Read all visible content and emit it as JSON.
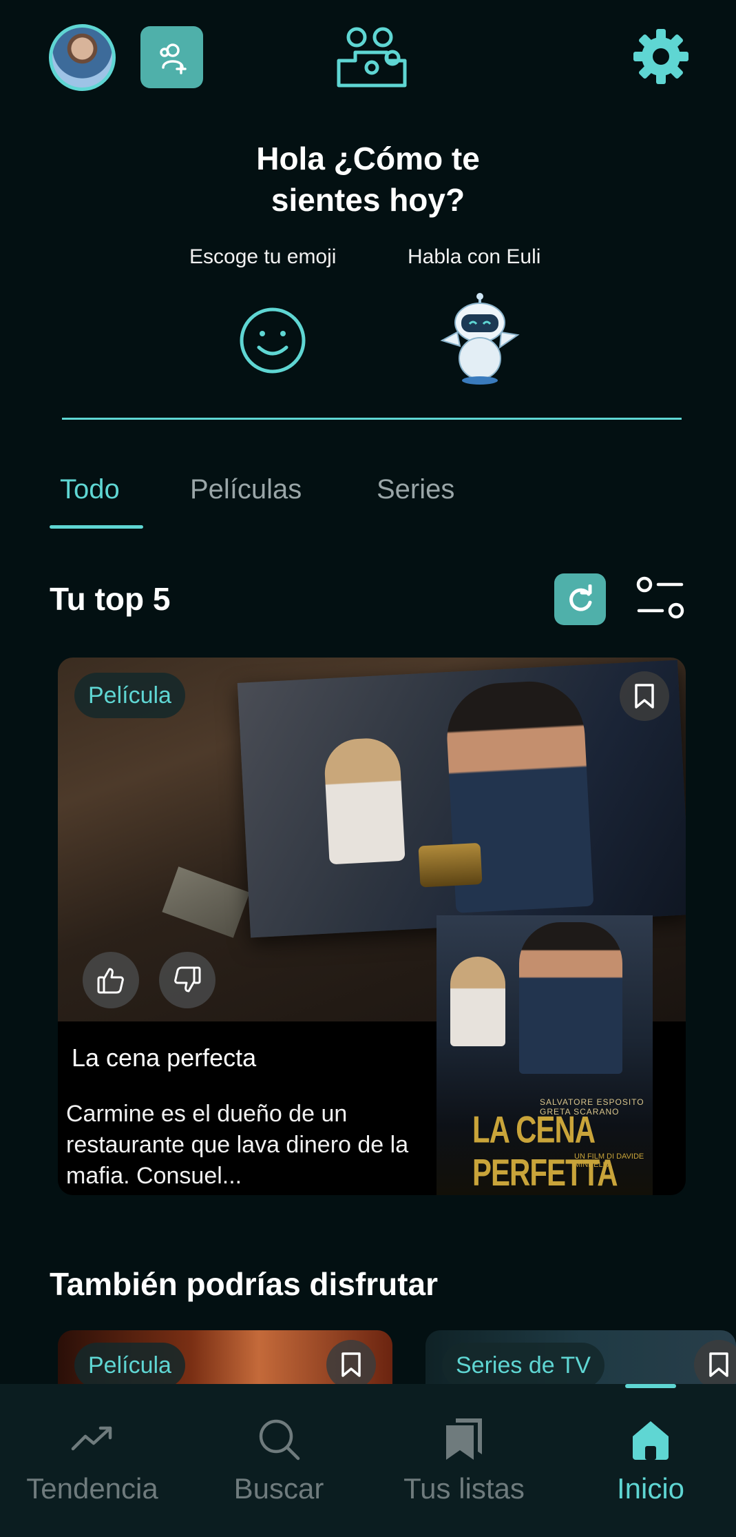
{
  "header": {
    "avatar_alt": "Foto de perfil",
    "add_user": "Agregar usuario",
    "family": "Familia",
    "settings": "Ajustes"
  },
  "greeting": {
    "title": "Hola ¿Cómo te\nsientes hoy?",
    "emoji_label": "Escoge tu emoji",
    "chat_label": "Habla con Euli"
  },
  "tabs": [
    {
      "label": "Todo",
      "active": true
    },
    {
      "label": "Películas",
      "active": false
    },
    {
      "label": "Series",
      "active": false
    }
  ],
  "top5": {
    "title": "Tu top 5",
    "card": {
      "badge": "Película",
      "title": "La cena perfecta",
      "description": "Carmine es el dueño de un restaurante que lava dinero de la mafia. Consuel...",
      "poster_title": "LA CENA PERFETTA",
      "poster_credits": "SALVATORE ESPOSITO   GRETA SCARANO",
      "poster_director": "UN FILM DI DAVIDE MINNELLA"
    }
  },
  "also": {
    "title": "También podrías disfrutar",
    "cards": [
      {
        "badge": "Película"
      },
      {
        "badge": "Series de TV"
      }
    ]
  },
  "bottom_nav": [
    {
      "label": "Tendencia",
      "icon": "trending-icon",
      "active": false
    },
    {
      "label": "Buscar",
      "icon": "search-icon",
      "active": false
    },
    {
      "label": "Tus listas",
      "icon": "bookmarks-icon",
      "active": false
    },
    {
      "label": "Inicio",
      "icon": "home-icon",
      "active": true
    }
  ],
  "colors": {
    "accent": "#5fd6d3",
    "button_bg": "#4fb0aa",
    "background": "#031012",
    "nav_bg": "#0b1d20",
    "inactive": "#6f7b7d"
  }
}
